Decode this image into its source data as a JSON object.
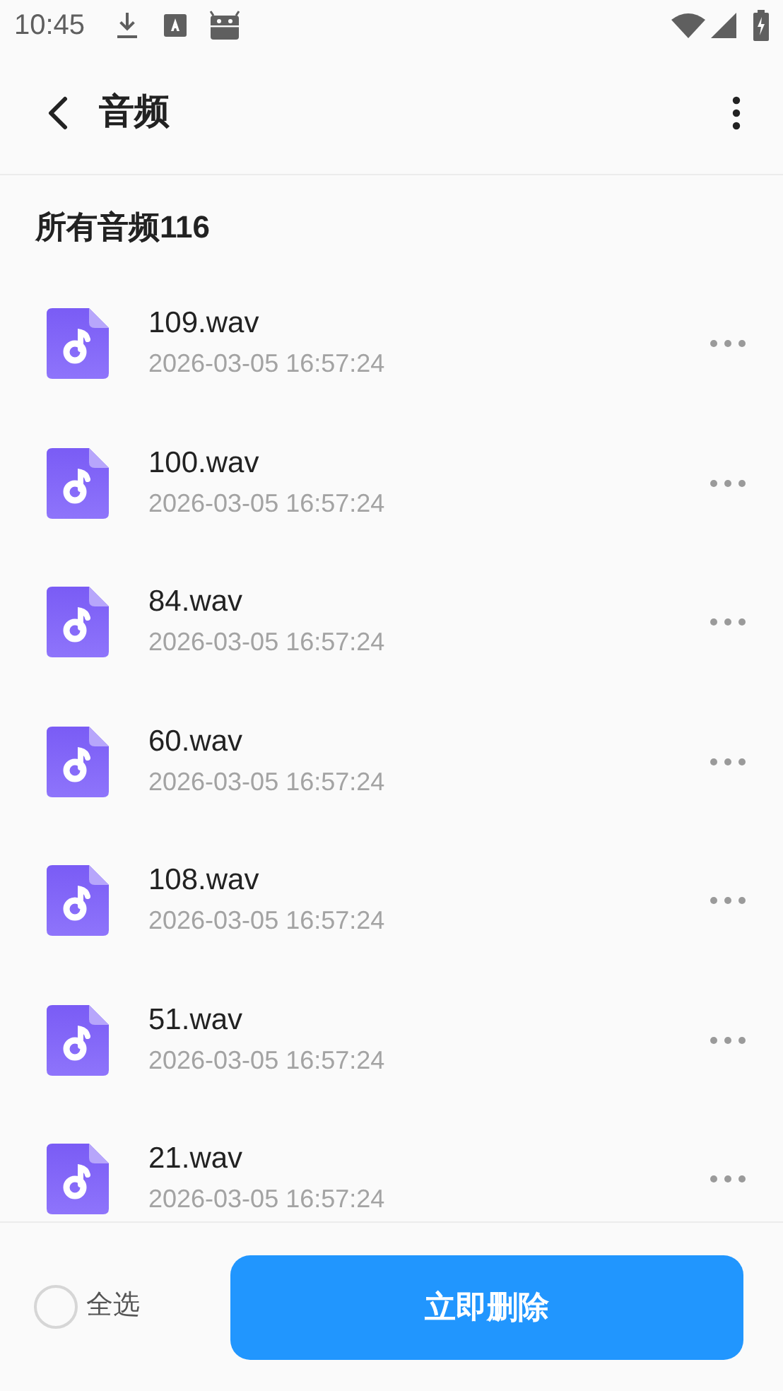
{
  "status_bar": {
    "time": "10:45"
  },
  "header": {
    "title": "音频"
  },
  "section": {
    "title": "所有音频116"
  },
  "files": [
    {
      "name": "109.wav",
      "date": "2026-03-05 16:57:24"
    },
    {
      "name": "100.wav",
      "date": "2026-03-05 16:57:24"
    },
    {
      "name": "84.wav",
      "date": "2026-03-05 16:57:24"
    },
    {
      "name": "60.wav",
      "date": "2026-03-05 16:57:24"
    },
    {
      "name": "108.wav",
      "date": "2026-03-05 16:57:24"
    },
    {
      "name": "51.wav",
      "date": "2026-03-05 16:57:24"
    },
    {
      "name": "21.wav",
      "date": "2026-03-05 16:57:24"
    }
  ],
  "bottom_bar": {
    "select_all": {
      "label": "全选",
      "checked": false
    },
    "delete_button": "立即删除"
  }
}
